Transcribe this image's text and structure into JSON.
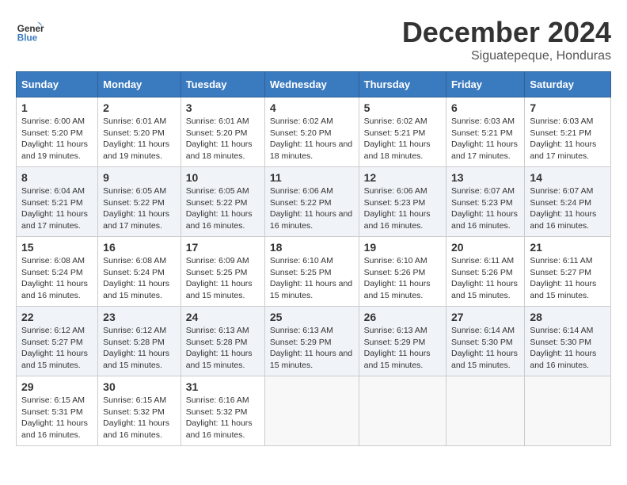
{
  "header": {
    "logo_line1": "General",
    "logo_line2": "Blue",
    "month": "December 2024",
    "location": "Siguatepeque, Honduras"
  },
  "weekdays": [
    "Sunday",
    "Monday",
    "Tuesday",
    "Wednesday",
    "Thursday",
    "Friday",
    "Saturday"
  ],
  "weeks": [
    [
      {
        "day": "1",
        "sunrise": "6:00 AM",
        "sunset": "5:20 PM",
        "daylight": "11 hours and 19 minutes."
      },
      {
        "day": "2",
        "sunrise": "6:01 AM",
        "sunset": "5:20 PM",
        "daylight": "11 hours and 19 minutes."
      },
      {
        "day": "3",
        "sunrise": "6:01 AM",
        "sunset": "5:20 PM",
        "daylight": "11 hours and 18 minutes."
      },
      {
        "day": "4",
        "sunrise": "6:02 AM",
        "sunset": "5:20 PM",
        "daylight": "11 hours and 18 minutes."
      },
      {
        "day": "5",
        "sunrise": "6:02 AM",
        "sunset": "5:21 PM",
        "daylight": "11 hours and 18 minutes."
      },
      {
        "day": "6",
        "sunrise": "6:03 AM",
        "sunset": "5:21 PM",
        "daylight": "11 hours and 17 minutes."
      },
      {
        "day": "7",
        "sunrise": "6:03 AM",
        "sunset": "5:21 PM",
        "daylight": "11 hours and 17 minutes."
      }
    ],
    [
      {
        "day": "8",
        "sunrise": "6:04 AM",
        "sunset": "5:21 PM",
        "daylight": "11 hours and 17 minutes."
      },
      {
        "day": "9",
        "sunrise": "6:05 AM",
        "sunset": "5:22 PM",
        "daylight": "11 hours and 17 minutes."
      },
      {
        "day": "10",
        "sunrise": "6:05 AM",
        "sunset": "5:22 PM",
        "daylight": "11 hours and 16 minutes."
      },
      {
        "day": "11",
        "sunrise": "6:06 AM",
        "sunset": "5:22 PM",
        "daylight": "11 hours and 16 minutes."
      },
      {
        "day": "12",
        "sunrise": "6:06 AM",
        "sunset": "5:23 PM",
        "daylight": "11 hours and 16 minutes."
      },
      {
        "day": "13",
        "sunrise": "6:07 AM",
        "sunset": "5:23 PM",
        "daylight": "11 hours and 16 minutes."
      },
      {
        "day": "14",
        "sunrise": "6:07 AM",
        "sunset": "5:24 PM",
        "daylight": "11 hours and 16 minutes."
      }
    ],
    [
      {
        "day": "15",
        "sunrise": "6:08 AM",
        "sunset": "5:24 PM",
        "daylight": "11 hours and 16 minutes."
      },
      {
        "day": "16",
        "sunrise": "6:08 AM",
        "sunset": "5:24 PM",
        "daylight": "11 hours and 15 minutes."
      },
      {
        "day": "17",
        "sunrise": "6:09 AM",
        "sunset": "5:25 PM",
        "daylight": "11 hours and 15 minutes."
      },
      {
        "day": "18",
        "sunrise": "6:10 AM",
        "sunset": "5:25 PM",
        "daylight": "11 hours and 15 minutes."
      },
      {
        "day": "19",
        "sunrise": "6:10 AM",
        "sunset": "5:26 PM",
        "daylight": "11 hours and 15 minutes."
      },
      {
        "day": "20",
        "sunrise": "6:11 AM",
        "sunset": "5:26 PM",
        "daylight": "11 hours and 15 minutes."
      },
      {
        "day": "21",
        "sunrise": "6:11 AM",
        "sunset": "5:27 PM",
        "daylight": "11 hours and 15 minutes."
      }
    ],
    [
      {
        "day": "22",
        "sunrise": "6:12 AM",
        "sunset": "5:27 PM",
        "daylight": "11 hours and 15 minutes."
      },
      {
        "day": "23",
        "sunrise": "6:12 AM",
        "sunset": "5:28 PM",
        "daylight": "11 hours and 15 minutes."
      },
      {
        "day": "24",
        "sunrise": "6:13 AM",
        "sunset": "5:28 PM",
        "daylight": "11 hours and 15 minutes."
      },
      {
        "day": "25",
        "sunrise": "6:13 AM",
        "sunset": "5:29 PM",
        "daylight": "11 hours and 15 minutes."
      },
      {
        "day": "26",
        "sunrise": "6:13 AM",
        "sunset": "5:29 PM",
        "daylight": "11 hours and 15 minutes."
      },
      {
        "day": "27",
        "sunrise": "6:14 AM",
        "sunset": "5:30 PM",
        "daylight": "11 hours and 15 minutes."
      },
      {
        "day": "28",
        "sunrise": "6:14 AM",
        "sunset": "5:30 PM",
        "daylight": "11 hours and 16 minutes."
      }
    ],
    [
      {
        "day": "29",
        "sunrise": "6:15 AM",
        "sunset": "5:31 PM",
        "daylight": "11 hours and 16 minutes."
      },
      {
        "day": "30",
        "sunrise": "6:15 AM",
        "sunset": "5:32 PM",
        "daylight": "11 hours and 16 minutes."
      },
      {
        "day": "31",
        "sunrise": "6:16 AM",
        "sunset": "5:32 PM",
        "daylight": "11 hours and 16 minutes."
      },
      null,
      null,
      null,
      null
    ]
  ]
}
